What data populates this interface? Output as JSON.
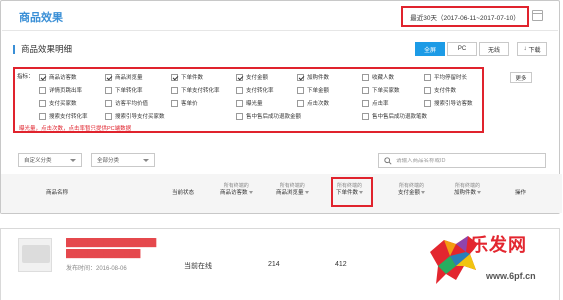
{
  "header": {
    "title": "商品效果",
    "date_range": "最近30天（2017-06-11~2017-07-10）"
  },
  "section": {
    "title": "商品效果明细",
    "segments": [
      {
        "label": "全屏",
        "active": true
      },
      {
        "label": "PC",
        "active": false
      },
      {
        "label": "无线",
        "active": false
      }
    ],
    "download_label": "下载"
  },
  "metrics": {
    "prefix": "指标：",
    "items": [
      {
        "label": "商品访客数",
        "checked": true
      },
      {
        "label": "商品浏览量",
        "checked": true
      },
      {
        "label": "下单件数",
        "checked": true
      },
      {
        "label": "支付金额",
        "checked": true
      },
      {
        "label": "加购件数",
        "checked": true
      },
      {
        "label": "收藏人数",
        "checked": false
      },
      {
        "label": "平均停留时长",
        "checked": false
      },
      {
        "label": "详情页跳出率",
        "checked": false
      },
      {
        "label": "下单转化率",
        "checked": false
      },
      {
        "label": "下单支付转化率",
        "checked": false
      },
      {
        "label": "支付转化率",
        "checked": false
      },
      {
        "label": "下单金额",
        "checked": false
      },
      {
        "label": "下单买家数",
        "checked": false
      },
      {
        "label": "支付件数",
        "checked": false
      },
      {
        "label": "支付买家数",
        "checked": false
      },
      {
        "label": "访客平均价值",
        "checked": false
      },
      {
        "label": "客单价",
        "checked": false
      },
      {
        "label": "曝光量",
        "checked": false
      },
      {
        "label": "点击次数",
        "checked": false
      },
      {
        "label": "点击率",
        "checked": false
      },
      {
        "label": "搜索引导访客数",
        "checked": false
      },
      {
        "label": "搜索支付转化率",
        "checked": false
      },
      {
        "label": "搜索引导支付买家数",
        "checked": false
      },
      {
        "label": "售中售后成功退款金额",
        "checked": false
      },
      {
        "label": "售中售后成功退款笔数",
        "checked": false
      }
    ],
    "note": "曝光量，点击次数，点击率暂只提供PC端数据",
    "more_label": "更多"
  },
  "filters": {
    "category1": "自定义分类",
    "category2": "全部分类",
    "search_placeholder": "请输入商品名称或ID"
  },
  "table": {
    "columns": {
      "name": "商品名称",
      "status": "当前状态",
      "visitors_prefix": "所有终端的",
      "visitors": "商品访客数",
      "views_prefix": "所有终端的",
      "views": "商品浏览量",
      "orders_prefix": "所有终端的",
      "orders": "下单件数",
      "pay_prefix": "所有终端的",
      "pay": "支付金额",
      "cart_prefix": "所有终端的",
      "cart": "加购件数",
      "action": "操作"
    },
    "rows": [
      {
        "status": "当前在线",
        "visitors": "214",
        "views": "412",
        "published": "发布时间：2016-08-06"
      }
    ]
  },
  "watermark": {
    "brand": "乐发网",
    "url": "www.6pf.cn"
  },
  "colors": {
    "accent": "#1c9be6",
    "highlight": "#e0232d"
  }
}
